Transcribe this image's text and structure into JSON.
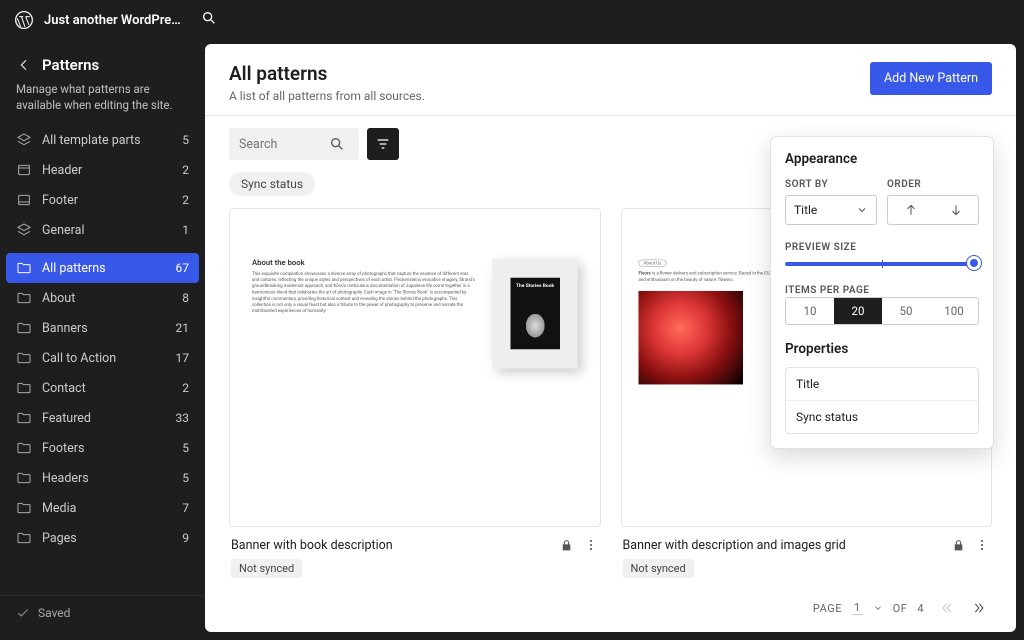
{
  "topbar": {
    "site_name": "Just another WordPre…"
  },
  "sidebar": {
    "title": "Patterns",
    "description": "Manage what patterns are available when editing the site.",
    "template_parts": [
      {
        "label": "All template parts",
        "count": 5,
        "icon": "layers"
      },
      {
        "label": "Header",
        "count": 2,
        "icon": "layout"
      },
      {
        "label": "Footer",
        "count": 2,
        "icon": "layout"
      },
      {
        "label": "General",
        "count": 1,
        "icon": "layers"
      }
    ],
    "pattern_categories": [
      {
        "label": "All patterns",
        "count": 67,
        "active": true
      },
      {
        "label": "About",
        "count": 8
      },
      {
        "label": "Banners",
        "count": 21
      },
      {
        "label": "Call to Action",
        "count": 17
      },
      {
        "label": "Contact",
        "count": 2
      },
      {
        "label": "Featured",
        "count": 33
      },
      {
        "label": "Footers",
        "count": 5
      },
      {
        "label": "Headers",
        "count": 5
      },
      {
        "label": "Media",
        "count": 7
      },
      {
        "label": "Pages",
        "count": 9
      }
    ],
    "saved": "Saved"
  },
  "page": {
    "title": "All patterns",
    "subtitle": "A list of all patterns from all sources.",
    "add_button": "Add New Pattern",
    "search_placeholder": "Search",
    "chip_sync": "Sync status"
  },
  "patterns": [
    {
      "title": "Banner with book description",
      "sync": "Not synced",
      "preview": {
        "heading": "About the book",
        "body": "This exquisite compilation showcases a diverse array of photographs that capture the essence of different eras and cultures, reflecting the unique styles and perspectives of each artist. Fleckensteins evocative imagery, Strand's groundbreaking modernist approach, and Kōno's meticulous documentation of Japanese life come together in a harmonious blend that celebrates the art of photography. Each image in \"The Stories Book\" is accompanied by insightful commentary, providing historical context and revealing the stories behind the photographs. This collection is not only a visual feast but also a tribute to the power of photography to preserve and narrate the multifaceted experiences of humanity.",
        "book_title": "The Stories Book"
      }
    },
    {
      "title": "Banner with description and images grid",
      "sync": "Not synced",
      "preview": {
        "badge": "About Us",
        "body_prefix": "Fleurs",
        "body": " is a flower delivery and subscription service. Based in the EU, our mission is not only to deliver stunning flower arrangements across but also to spread knowledge and enthusiasm on the beauty of nature: flowers."
      }
    }
  ],
  "pagination": {
    "label_page": "PAGE",
    "current": 1,
    "label_of": "OF",
    "total": 4
  },
  "popover": {
    "appearance_title": "Appearance",
    "sort_by_label": "SORT BY",
    "sort_by_value": "Title",
    "order_label": "ORDER",
    "preview_size_label": "PREVIEW SIZE",
    "items_per_page_label": "ITEMS PER PAGE",
    "items_options": [
      "10",
      "20",
      "50",
      "100"
    ],
    "items_selected": "20",
    "properties_title": "Properties",
    "properties": [
      "Title",
      "Sync status"
    ]
  }
}
